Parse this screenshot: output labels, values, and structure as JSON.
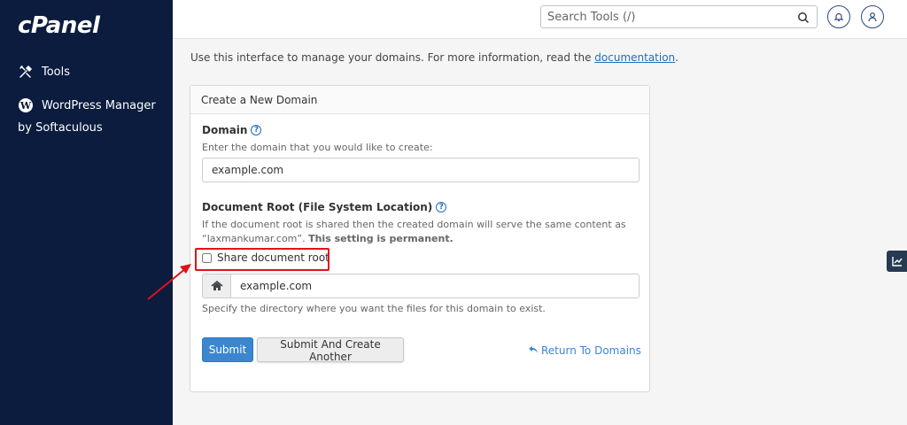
{
  "brand": {
    "logo": "cPanel"
  },
  "sidebar": {
    "items": [
      {
        "label": "Tools",
        "icon": "tools-icon"
      },
      {
        "label": "WordPress Manager",
        "label_line2": "by Softaculous",
        "icon": "wordpress-icon"
      }
    ]
  },
  "header": {
    "search_placeholder": "Search Tools (/)"
  },
  "main": {
    "intro_text": "Use this interface to manage your domains. For more information, read the ",
    "intro_link": "documentation",
    "intro_end": ".",
    "panel_title": "Create a New Domain",
    "domain_label": "Domain",
    "domain_hint": "Enter the domain that you would like to create:",
    "domain_value": "example.com",
    "docroot_label": "Document Root (File System Location)",
    "docroot_hint_1": "If the document root is shared then the created domain will serve the same content as",
    "docroot_hint_2a": "“laxmankumar.com”. ",
    "docroot_hint_2b": "This setting is permanent.",
    "share_label": "Share document root",
    "share_checked": false,
    "root_value": "example.com",
    "root_hint": "Specify the directory where you want the files for this domain to exist.",
    "submit_label": "Submit",
    "submit_another_label": "Submit And Create Another",
    "return_label": "Return To Domains"
  },
  "colors": {
    "sidebar_bg": "#0b1c3e",
    "primary": "#3b86cf",
    "highlight": "#e3101b"
  }
}
